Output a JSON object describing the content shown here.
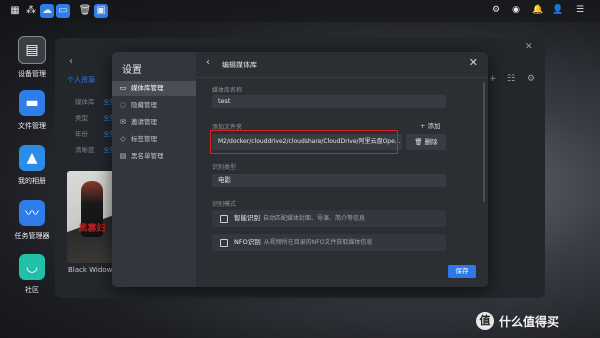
{
  "taskbar": {
    "left_icons": [
      "grid-icon",
      "share-icon",
      "cloud-icon",
      "window-icon",
      "trash-icon",
      "photo-icon"
    ],
    "right_icons": [
      "settings-icon",
      "user-icon",
      "bell-icon",
      "person-icon",
      "menu-icon"
    ]
  },
  "dock": [
    {
      "label": "设备管理",
      "icon": "device-manager-icon",
      "color": "#3a3d44"
    },
    {
      "label": "文件管理",
      "icon": "file-manager-icon",
      "color": "#2f7de8"
    },
    {
      "label": "我的相册",
      "icon": "album-icon",
      "color": "#2a8ee8"
    },
    {
      "label": "任务管理器",
      "icon": "task-manager-icon",
      "color": "#2f7de8"
    },
    {
      "label": "社区",
      "icon": "community-icon",
      "color": "#22c0a8"
    }
  ],
  "background_app": {
    "tab": "个人资源",
    "rows": [
      {
        "label": "媒体库",
        "value": "全部"
      },
      {
        "label": "类型",
        "value": "全部"
      },
      {
        "label": "年份",
        "value": "全部"
      },
      {
        "label": "清晰度",
        "value": "全部"
      }
    ],
    "poster_title": "黑寡妇",
    "poster_caption": "Black Widow"
  },
  "settings": {
    "title": "设置",
    "menu": [
      {
        "label": "媒体库管理",
        "icon": "library-icon",
        "active": true
      },
      {
        "label": "隐藏管理",
        "icon": "hide-icon",
        "active": false
      },
      {
        "label": "邀请管理",
        "icon": "invite-icon",
        "active": false
      },
      {
        "label": "标签管理",
        "icon": "tag-icon",
        "active": false
      },
      {
        "label": "黑名单管理",
        "icon": "blacklist-icon",
        "active": false
      }
    ]
  },
  "editor": {
    "title": "编辑媒体库",
    "name_label": "媒体库名称",
    "name_value": "test",
    "folder_label": "添加文件夹",
    "add_label": "添加",
    "folder_path": "M2/docker/clouddrive2/cloudshare/CloudDrive/阿里云盘Ope...",
    "delete_label": "删除",
    "type_label": "识别类型",
    "type_value": "电影",
    "mode_label": "识别模式",
    "modes": [
      {
        "name": "智能识别",
        "desc": "自动匹配媒体封面、导演、简介等信息"
      },
      {
        "name": "NFO识别",
        "desc": "从视频所在目录的NFO文件获取媒体信息"
      }
    ],
    "save_label": "保存"
  },
  "watermark": {
    "badge": "值",
    "text": "什么值得买"
  }
}
